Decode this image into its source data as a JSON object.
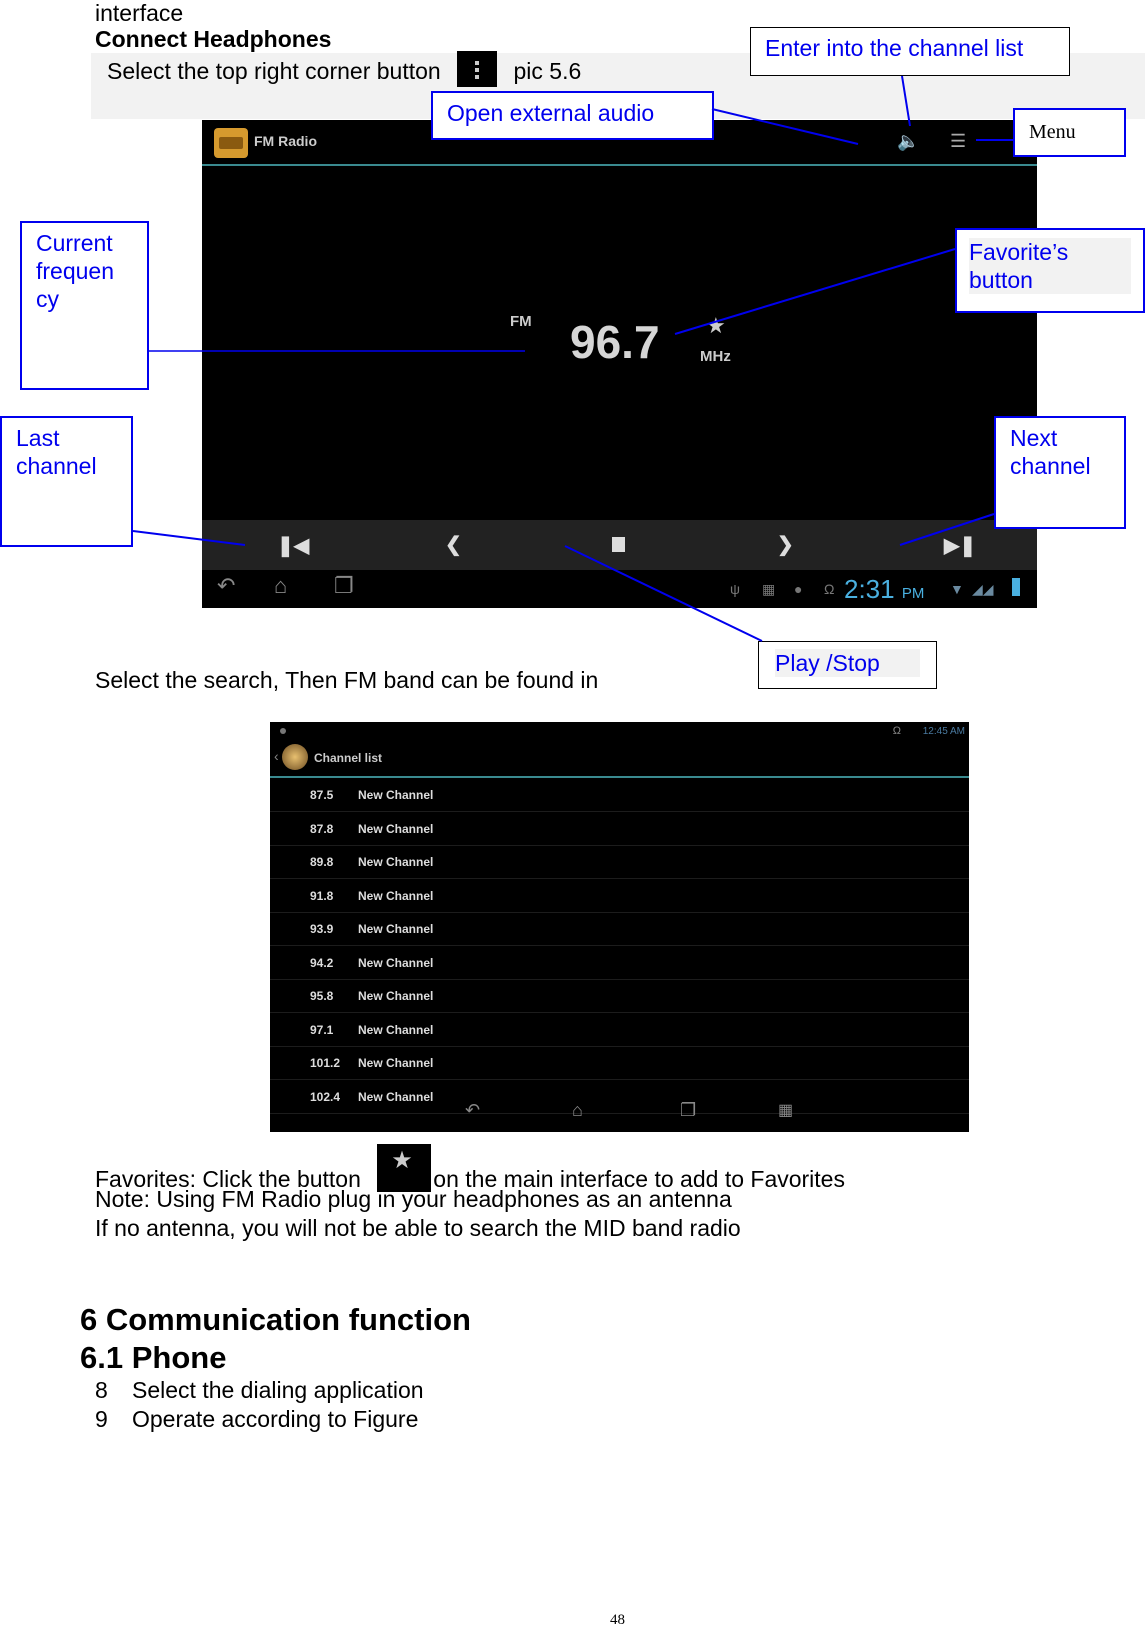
{
  "page": {
    "intro_fragment": "interface",
    "section_heading": "Connect Headphones",
    "instruction_prefix": "Select the top right corner button",
    "instruction_suffix": "pic 5.6",
    "search_line": "Select the search, Then FM band can be found in",
    "favorites_prefix": "Favorites: Click the button",
    "favorites_suffix": "on the main interface to add to Favorites",
    "note_line": "Note: Using FM Radio plug in your headphones as an antenna",
    "antenna_line": "If no antenna, you will not be able to search the MID band radio",
    "chapter_heading": "6 Communication function",
    "subsection_heading": "6.1 Phone",
    "steps": [
      {
        "num": "8",
        "text": "Select the dialing application"
      },
      {
        "num": "9",
        "text": "Operate according to Figure"
      }
    ],
    "page_number": "48"
  },
  "callouts": {
    "channel_list": "Enter into the channel list",
    "external_audio": "Open external audio",
    "menu": "Menu",
    "current_frequency": [
      "Current",
      "frequen",
      "cy"
    ],
    "favorites_button": [
      "Favorite’s",
      "button"
    ],
    "last_channel": [
      "Last",
      "channel"
    ],
    "next_channel": [
      "Next",
      "channel"
    ],
    "play_stop": "Play /Stop"
  },
  "fm_screen": {
    "app_title": "FM Radio",
    "band": "FM",
    "frequency": "96.7",
    "unit": "MHz",
    "clock_time": "2:31",
    "clock_ampm": "PM",
    "icons": {
      "speaker": "speaker-icon",
      "channel_list": "list-icon",
      "overflow": "overflow-menu-icon",
      "favorite": "star-icon",
      "prev_channel": "skip-previous-icon",
      "seek_back": "chevron-left-icon",
      "stop": "stop-icon",
      "seek_forward": "chevron-right-icon",
      "next_channel": "skip-next-icon"
    }
  },
  "channel_list_screen": {
    "title": "Channel list",
    "clock": "12:45 AM",
    "channels": [
      {
        "freq": "87.5",
        "name": "New Channel"
      },
      {
        "freq": "87.8",
        "name": "New Channel"
      },
      {
        "freq": "89.8",
        "name": "New Channel"
      },
      {
        "freq": "91.8",
        "name": "New Channel"
      },
      {
        "freq": "93.9",
        "name": "New Channel"
      },
      {
        "freq": "94.2",
        "name": "New Channel"
      },
      {
        "freq": "95.8",
        "name": "New Channel"
      },
      {
        "freq": "97.1",
        "name": "New Channel"
      },
      {
        "freq": "101.2",
        "name": "New Channel"
      },
      {
        "freq": "102.4",
        "name": "New Channel"
      }
    ]
  },
  "colors": {
    "callout_blue": "#0000ee",
    "accent_teal": "#3a8a8f",
    "clock_blue": "#4ab0e0"
  }
}
